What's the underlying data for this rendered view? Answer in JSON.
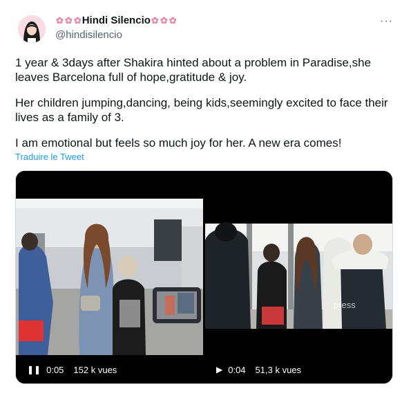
{
  "tweet": {
    "display_name": "Hindi Silencio",
    "handle": "@hindisilencio",
    "more_icon": "more-dots-icon",
    "paragraphs": [
      "1 year & 3days after Shakira hinted about a problem in Paradise,she leaves Barcelona full of hope,gratitude & joy.",
      "Her children jumping,dancing, being kids,seemingly excited to face their lives as a family of 3.",
      "I am emotional but feels so much joy for her. A new era comes!"
    ],
    "translate_label": "Traduire le Tweet",
    "link_color": "#1d9bf0"
  },
  "videos": [
    {
      "state_icon": "pause-icon",
      "time": "0:05",
      "views": "152 k vues",
      "watermark": ""
    },
    {
      "state_icon": "play-icon",
      "time": "0:04",
      "views": "51,3 k vues",
      "watermark": "press"
    }
  ]
}
